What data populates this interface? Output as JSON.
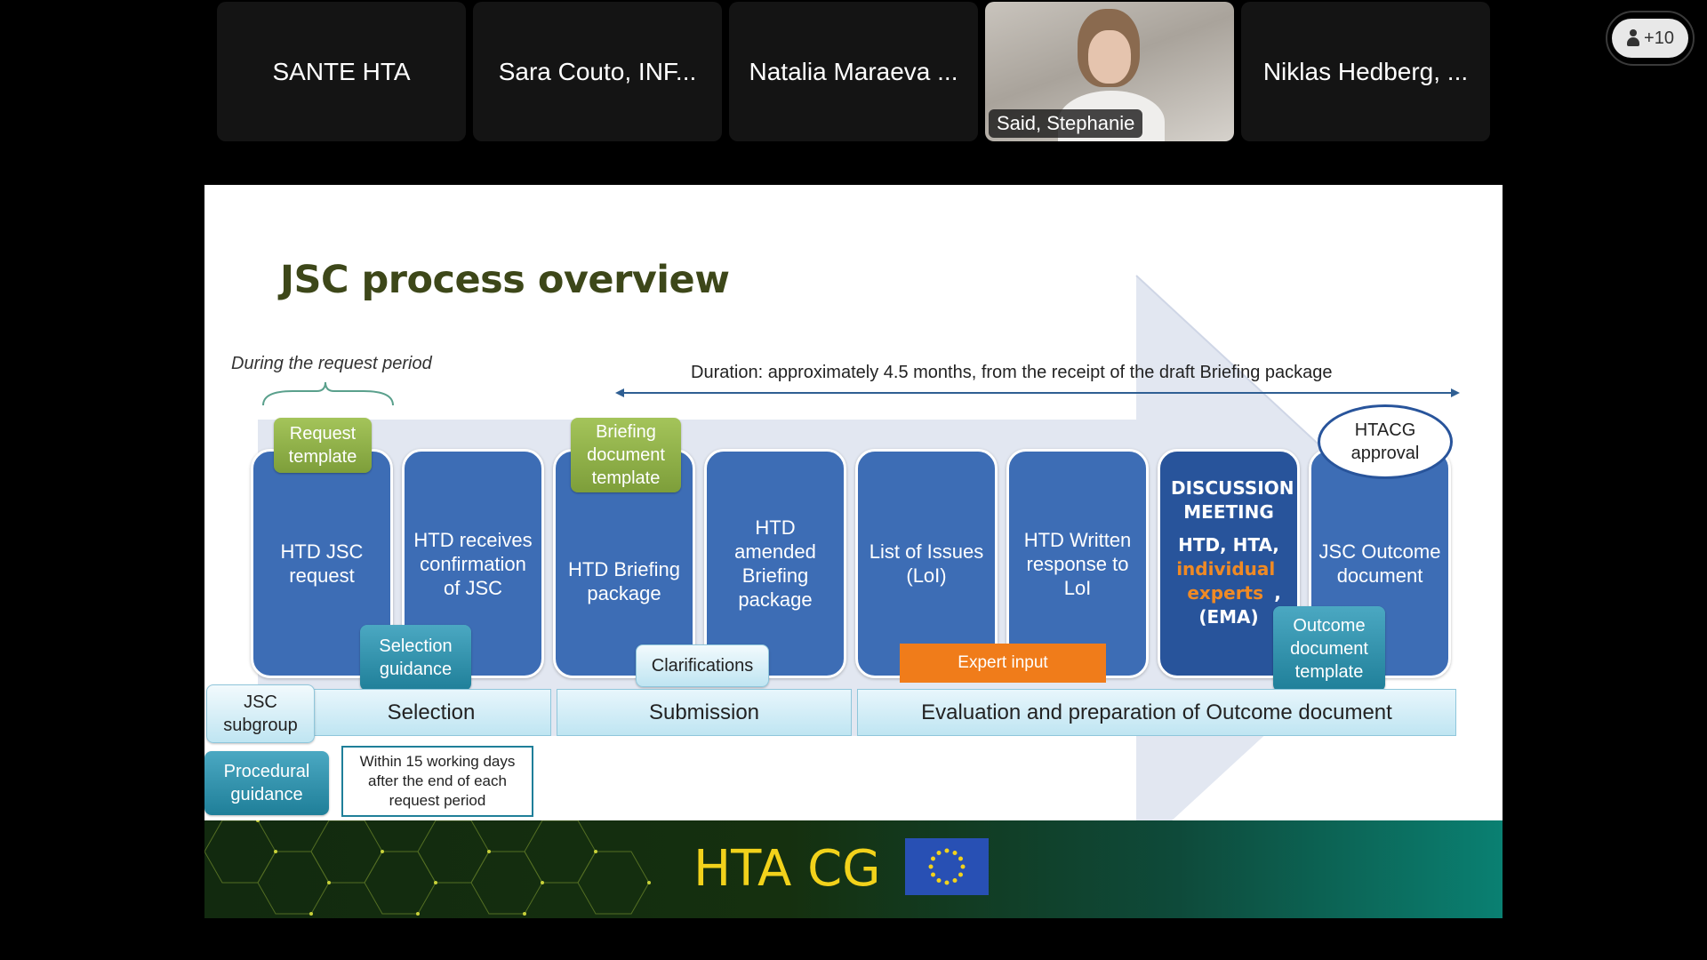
{
  "participants": [
    {
      "name": "SANTE HTA",
      "video": false
    },
    {
      "name": "Sara Couto, INF...",
      "video": false
    },
    {
      "name": "Natalia Maraeva ...",
      "video": false
    },
    {
      "name": "Said, Stephanie",
      "video": true
    },
    {
      "name": "Niklas Hedberg, ...",
      "video": false
    }
  ],
  "more_participants": "+10",
  "slide": {
    "title": "JSC process overview",
    "request_period": "During the request period",
    "duration": "Duration: approximately 4.5 months, from the receipt of the draft Briefing package",
    "steps": [
      {
        "label": "HTD JSC request"
      },
      {
        "label": "HTD receives confirmation of JSC"
      },
      {
        "label": "HTD Briefing package"
      },
      {
        "label": "HTD amended Briefing package"
      },
      {
        "label": "List of Issues (LoI)"
      },
      {
        "label": "HTD Written response to LoI"
      },
      {
        "label": "JSC Outcome document"
      }
    ],
    "discussion": {
      "heading": "DISCUSSION MEETING",
      "line1": "HTD, HTA,",
      "highlight": "individual experts",
      "comma": ",",
      "line3": "(EMA)"
    },
    "approval": "HTACG approval",
    "green_tags": [
      "Request template",
      "Briefing document template"
    ],
    "teal_tags": [
      "Selection guidance",
      "Outcome document template",
      "Procedural guidance"
    ],
    "light_tags": [
      "Clarifications",
      "JSC subgroup"
    ],
    "expert_input": "Expert input",
    "phases": [
      "Selection",
      "Submission",
      "Evaluation and preparation of Outcome document"
    ],
    "note": "Within 15 working days after the end of each request period",
    "footer_title": "HTA CG",
    "colors": {
      "title": "#3d4719",
      "step": "#3d6db5",
      "step_dark": "#28549b",
      "orange": "#f07c1a",
      "footer_text": "#f2d21b"
    }
  }
}
